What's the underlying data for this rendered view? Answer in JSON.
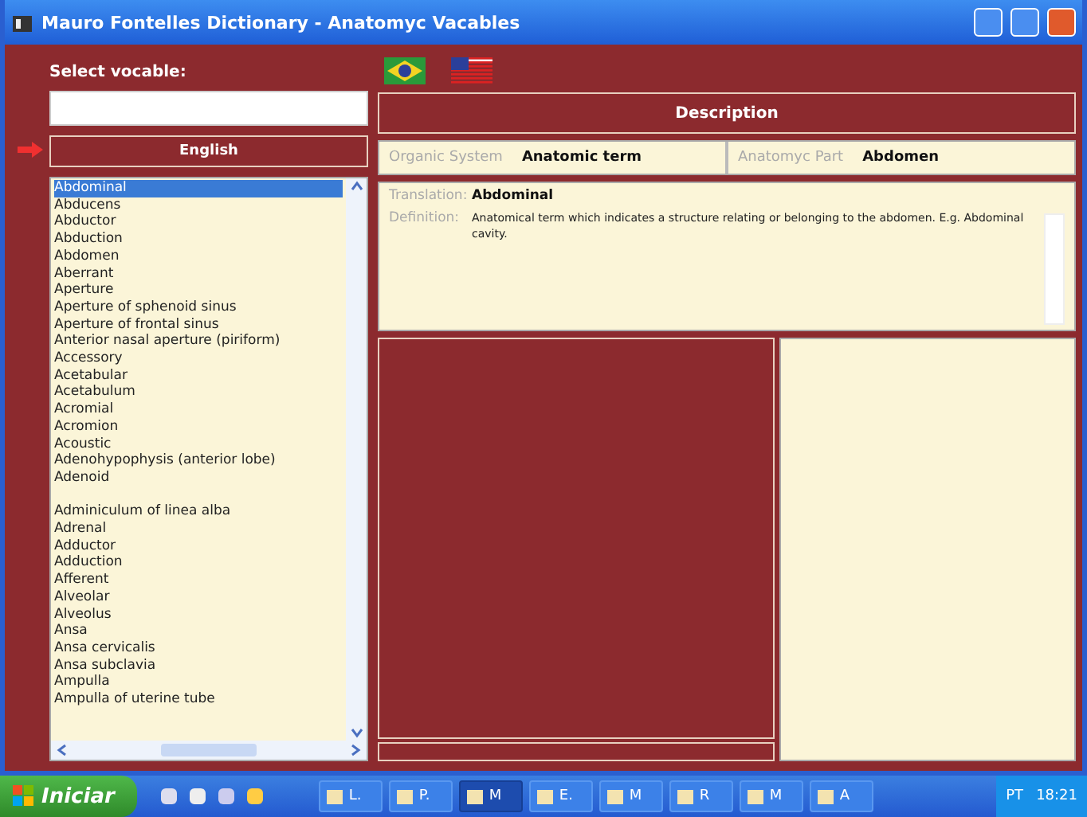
{
  "window": {
    "title": "Mauro Fontelles Dictionary - Anatomyc Vacables"
  },
  "search": {
    "label": "Select vocable:"
  },
  "language": {
    "label": "English"
  },
  "vocables": [
    {
      "text": "Abdominal",
      "selected": true
    },
    {
      "text": "Abducens",
      "selected": false
    },
    {
      "text": "Abductor",
      "selected": false
    },
    {
      "text": "Abduction",
      "selected": false
    },
    {
      "text": "Abdomen",
      "selected": false
    },
    {
      "text": "Aberrant",
      "selected": false
    },
    {
      "text": "Aperture",
      "selected": false
    },
    {
      "text": "Aperture of sphenoid sinus",
      "selected": false
    },
    {
      "text": "Aperture of frontal sinus",
      "selected": false
    },
    {
      "text": "Anterior nasal aperture (piriform)",
      "selected": false
    },
    {
      "text": "Accessory",
      "selected": false
    },
    {
      "text": "Acetabular",
      "selected": false
    },
    {
      "text": "Acetabulum",
      "selected": false
    },
    {
      "text": "Acromial",
      "selected": false
    },
    {
      "text": "Acromion",
      "selected": false
    },
    {
      "text": "Acoustic",
      "selected": false
    },
    {
      "text": "Adenohypophysis (anterior lobe)",
      "selected": false
    },
    {
      "text": "Adenoid",
      "selected": false
    },
    {
      "kind": "blank"
    },
    {
      "text": "Adminiculum of linea alba",
      "selected": false
    },
    {
      "text": "Adrenal",
      "selected": false
    },
    {
      "text": "Adductor",
      "selected": false
    },
    {
      "text": "Adduction",
      "selected": false
    },
    {
      "text": "Afferent",
      "selected": false
    },
    {
      "text": "Alveolar",
      "selected": false
    },
    {
      "text": "Alveolus",
      "selected": false
    },
    {
      "text": "Ansa",
      "selected": false
    },
    {
      "text": "Ansa cervicalis",
      "selected": false
    },
    {
      "text": "Ansa subclavia",
      "selected": false
    },
    {
      "text": "Ampulla",
      "selected": false
    },
    {
      "text": "Ampulla of uterine tube",
      "selected": false
    }
  ],
  "description": {
    "header": "Description",
    "organic_system": {
      "label": "Organic System",
      "value": "Anatomic term"
    },
    "anatomy_part": {
      "label": "Anatomyc Part",
      "value": "Abdomen"
    },
    "translation": {
      "label": "Translation:",
      "value": "Abdominal"
    },
    "definition": {
      "label": "Definition:",
      "value": "Anatomical term which indicates a structure relating or belonging to the abdomen. E.g. Abdominal cavity."
    }
  },
  "taskbar": {
    "start": "Iniciar",
    "buttons": [
      {
        "label": "L.",
        "selected": false
      },
      {
        "label": "P.",
        "selected": false
      },
      {
        "label": "M",
        "selected": true
      },
      {
        "label": "E.",
        "selected": false
      },
      {
        "label": "M",
        "selected": false
      },
      {
        "label": "R",
        "selected": false
      },
      {
        "label": "M",
        "selected": false
      },
      {
        "label": "A",
        "selected": false
      }
    ],
    "language": "PT",
    "clock": "18:21"
  }
}
